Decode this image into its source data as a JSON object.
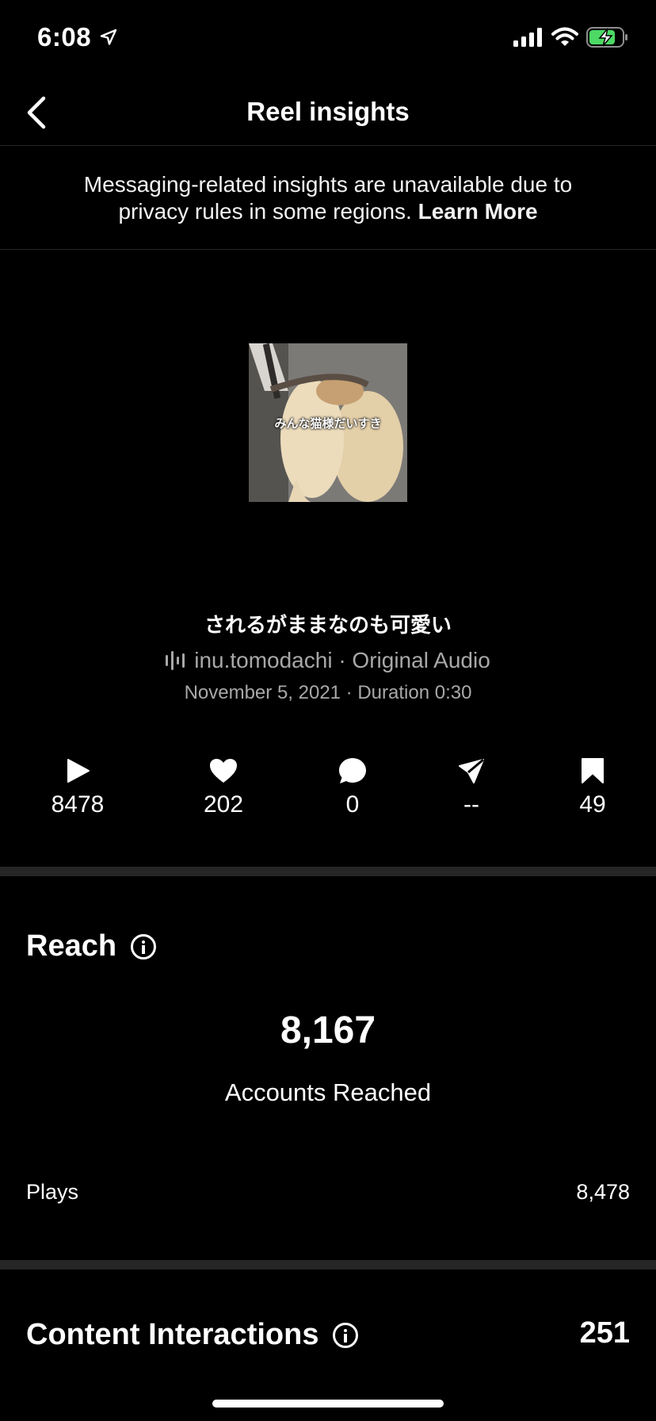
{
  "status_bar": {
    "time": "6:08"
  },
  "nav": {
    "title": "Reel insights"
  },
  "notice": {
    "text": "Messaging-related insights are unavailable due to privacy rules in some regions.",
    "link": "Learn More"
  },
  "reel": {
    "thumbnail_caption": "みんな猫様だいすき",
    "title": "されるがままなのも可愛い",
    "audio": "inu.tomodachi · Original Audio",
    "meta": "November 5, 2021 · Duration 0:30"
  },
  "stats": [
    {
      "icon": "play-icon",
      "value": "8478"
    },
    {
      "icon": "heart-icon",
      "value": "202"
    },
    {
      "icon": "comment-icon",
      "value": "0"
    },
    {
      "icon": "share-icon",
      "value": "--"
    },
    {
      "icon": "bookmark-icon",
      "value": "49"
    }
  ],
  "reach": {
    "title": "Reach",
    "accounts_reached_value": "8,167",
    "accounts_reached_label": "Accounts Reached",
    "plays_label": "Plays",
    "plays_value": "8,478"
  },
  "content_interactions": {
    "title": "Content Interactions",
    "value": "251"
  },
  "colors": {
    "background": "#000000",
    "secondary_text": "#a8a8a8",
    "divider": "#262626"
  }
}
